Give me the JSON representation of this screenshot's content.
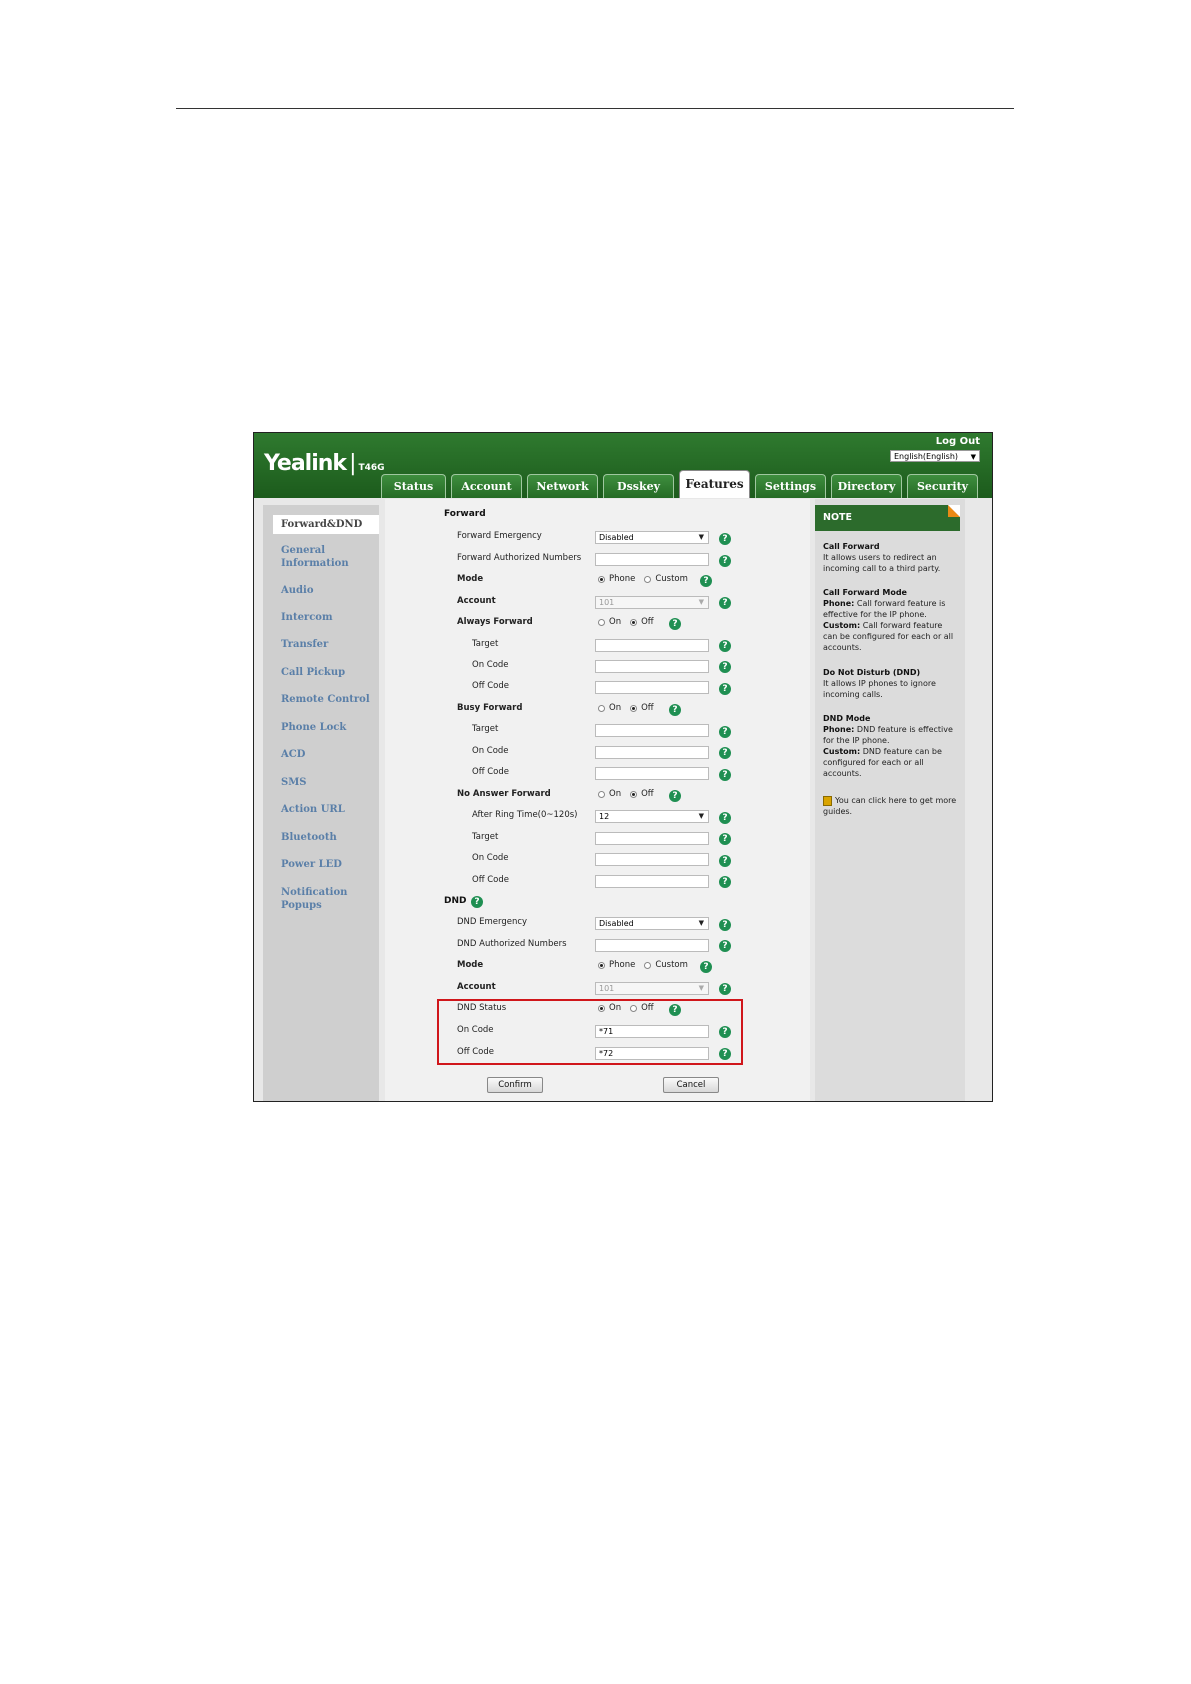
{
  "header": {
    "logo": "Yealink",
    "model": "T46G",
    "logout": "Log Out",
    "language": "English(English)"
  },
  "tabs": [
    "Status",
    "Account",
    "Network",
    "Dsskey",
    "Features",
    "Settings",
    "Directory",
    "Security"
  ],
  "active_tab": "Features",
  "sidebar": {
    "items": [
      "Forward&DND",
      "General\nInformation",
      "Audio",
      "Intercom",
      "Transfer",
      "Call Pickup",
      "Remote Control",
      "Phone Lock",
      "ACD",
      "SMS",
      "Action URL",
      "Bluetooth",
      "Power LED",
      "Notification Popups"
    ],
    "selected": "Forward&DND"
  },
  "form": {
    "forward": {
      "section": "Forward",
      "emergency_label": "Forward Emergency",
      "emergency_value": "Disabled",
      "authorized_label": "Forward Authorized Numbers",
      "authorized_value": "",
      "mode_label": "Mode",
      "mode_phone": "Phone",
      "mode_custom": "Custom",
      "account_label": "Account",
      "account_value": "101",
      "always_label": "Always Forward",
      "busy_label": "Busy Forward",
      "noanswer_label": "No Answer Forward",
      "ring_label": "After Ring Time(0~120s)",
      "ring_value": "12",
      "target_label": "Target",
      "on_code_label": "On Code",
      "off_code_label": "Off Code",
      "on": "On",
      "off": "Off"
    },
    "dnd": {
      "section": "DND",
      "emergency_label": "DND Emergency",
      "emergency_value": "Disabled",
      "authorized_label": "DND Authorized Numbers",
      "mode_label": "Mode",
      "account_label": "Account",
      "account_value": "101",
      "status_label": "DND Status",
      "on_code_label": "On Code",
      "on_code_value": "*71",
      "off_code_label": "Off Code",
      "off_code_value": "*72"
    },
    "help": "?",
    "confirm": "Confirm",
    "cancel": "Cancel"
  },
  "note": {
    "title": "NOTE",
    "cf_title": "Call Forward",
    "cf_text": "It allows users to redirect an incoming call to a third party.",
    "cfm_title": "Call Forward Mode",
    "cfm_phone_label": "Phone:",
    "cfm_phone_text": "Call forward feature is effective for the IP phone.",
    "cfm_custom_label": "Custom:",
    "cfm_custom_text": "Call forward feature can be configured for each or all accounts.",
    "dnd_title": "Do Not Disturb (DND)",
    "dnd_text": "It allows IP phones to ignore incoming calls.",
    "dndm_title": "DND Mode",
    "dndm_phone_label": "Phone:",
    "dndm_phone_text": "DND feature is effective for the IP phone.",
    "dndm_custom_label": "Custom:",
    "dndm_custom_text": "DND feature can be configured for each or all accounts.",
    "guide_text": "You can click here to get more guides."
  }
}
